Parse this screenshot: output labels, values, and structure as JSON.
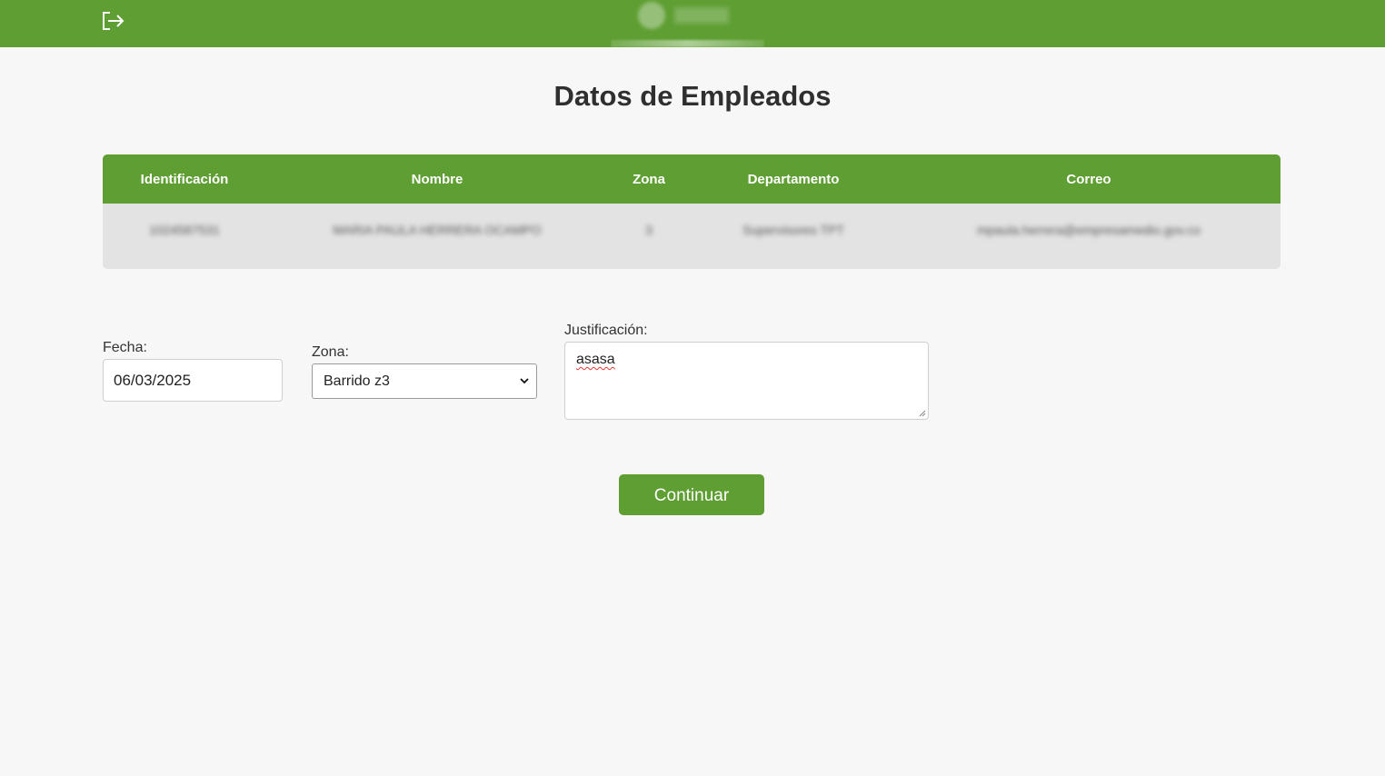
{
  "header": {
    "logout_icon": "logout-icon",
    "logo": "organization-logo"
  },
  "page_title": "Datos de Empleados",
  "table": {
    "headers": [
      "Identificación",
      "Nombre",
      "Zona",
      "Departamento",
      "Correo"
    ],
    "rows": [
      [
        "1024587531",
        "MARIA PAULA HERRERA OCAMPO",
        "3",
        "Supervisores TPT",
        "mpaula.herrera@empresamedio.gov.co"
      ]
    ]
  },
  "form": {
    "fecha": {
      "label": "Fecha:",
      "value": "06/03/2025"
    },
    "zona": {
      "label": "Zona:",
      "selected": "Barrido z3"
    },
    "justificacion": {
      "label": "Justificación:",
      "value": "asasa"
    },
    "continue_label": "Continuar"
  },
  "colors": {
    "brand_green": "#5e9e32",
    "background": "#f7f7f7",
    "table_row": "#e3e3e3"
  }
}
